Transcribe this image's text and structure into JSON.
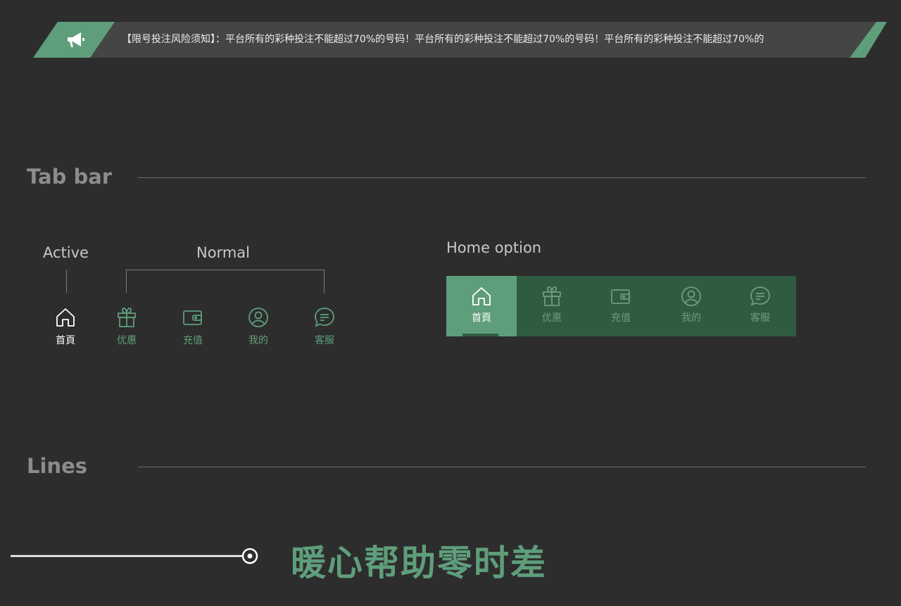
{
  "notice": {
    "icon": "megaphone-icon",
    "text": "【限号投注风险须知】：平台所有的彩种投注不能超过70%的号码！平台所有的彩种投注不能超过70%的号码！平台所有的彩种投注不能超过70%的"
  },
  "sections": {
    "tab_bar_title": "Tab bar",
    "lines_title": "Lines"
  },
  "tab_demo": {
    "active_label": "Active",
    "normal_label": "Normal",
    "items": [
      {
        "label": "首頁",
        "icon": "home-icon",
        "state": "active"
      },
      {
        "label": "优惠",
        "icon": "gift-icon",
        "state": "normal"
      },
      {
        "label": "充值",
        "icon": "wallet-icon",
        "state": "normal"
      },
      {
        "label": "我的",
        "icon": "user-icon",
        "state": "normal"
      },
      {
        "label": "客服",
        "icon": "chat-icon",
        "state": "normal"
      }
    ]
  },
  "home_option": {
    "title": "Home option",
    "items": [
      {
        "label": "首頁",
        "icon": "home-icon",
        "state": "active"
      },
      {
        "label": "优惠",
        "icon": "gift-icon",
        "state": "normal"
      },
      {
        "label": "充值",
        "icon": "wallet-icon",
        "state": "normal"
      },
      {
        "label": "我的",
        "icon": "user-icon",
        "state": "normal"
      },
      {
        "label": "客服",
        "icon": "chat-icon",
        "state": "normal"
      }
    ]
  },
  "lines_demo": {
    "slogan": "暖心帮助零时差"
  },
  "colors": {
    "background": "#2d2d2d",
    "accent_green": "#5f9e7b",
    "dark_green": "#2f5c41",
    "notice_bg": "#454545"
  }
}
